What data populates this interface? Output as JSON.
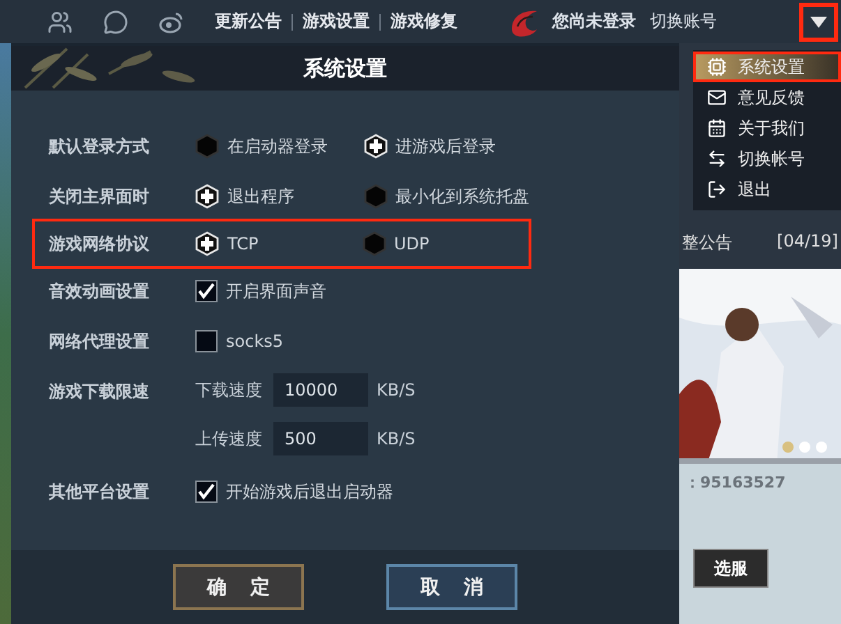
{
  "top_bar": {
    "links": [
      "更新公告",
      "游戏设置",
      "游戏修复"
    ],
    "login_status": "您尚未登录",
    "switch_account": "切换账号",
    "menu_button": {
      "highlighted": true
    }
  },
  "dialog": {
    "title": "系统设置",
    "settings": [
      {
        "kind": "radio",
        "label": "默认登录方式",
        "highlighted": false,
        "options": [
          {
            "label": "在启动器登录",
            "selected": false
          },
          {
            "label": "进游戏后登录",
            "selected": true
          }
        ]
      },
      {
        "kind": "radio",
        "label": "关闭主界面时",
        "highlighted": false,
        "options": [
          {
            "label": "退出程序",
            "selected": true
          },
          {
            "label": "最小化到系统托盘",
            "selected": false
          }
        ]
      },
      {
        "kind": "radio",
        "label": "游戏网络协议",
        "highlighted": true,
        "options": [
          {
            "label": "TCP",
            "selected": true
          },
          {
            "label": "UDP",
            "selected": false
          }
        ]
      },
      {
        "kind": "checkbox",
        "label": "音效动画设置",
        "highlighted": false,
        "options": [
          {
            "label": "开启界面声音",
            "checked": true
          }
        ]
      },
      {
        "kind": "checkbox",
        "label": "网络代理设置",
        "highlighted": false,
        "options": [
          {
            "label": "socks5",
            "checked": false
          }
        ]
      },
      {
        "kind": "speed",
        "label": "游戏下载限速",
        "highlighted": false,
        "fields": [
          {
            "label": "下载速度",
            "value": "10000",
            "unit": "KB/S"
          },
          {
            "label": "上传速度",
            "value": "500",
            "unit": "KB/S"
          }
        ]
      },
      {
        "kind": "checkbox",
        "label": "其他平台设置",
        "highlighted": false,
        "options": [
          {
            "label": "开始游戏后退出启动器",
            "checked": true
          }
        ]
      }
    ],
    "buttons": [
      {
        "kind": "confirm",
        "label": "确 定"
      },
      {
        "kind": "cancel",
        "label": "取 消"
      }
    ]
  },
  "menu": {
    "items": [
      {
        "kind": "settings",
        "label": "系统设置",
        "selected": true,
        "highlighted": true
      },
      {
        "kind": "feedback",
        "label": "意见反馈",
        "selected": false,
        "highlighted": false
      },
      {
        "kind": "about",
        "label": "关于我们",
        "selected": false,
        "highlighted": false
      },
      {
        "kind": "switch",
        "label": "切换帐号",
        "selected": false,
        "highlighted": false
      },
      {
        "kind": "exit",
        "label": "退出",
        "selected": false,
        "highlighted": false
      }
    ]
  },
  "background": {
    "news": [
      {
        "title": "整公告",
        "date": "[04/19]"
      }
    ],
    "group_number": "：95163527",
    "server_button": "选服"
  }
}
